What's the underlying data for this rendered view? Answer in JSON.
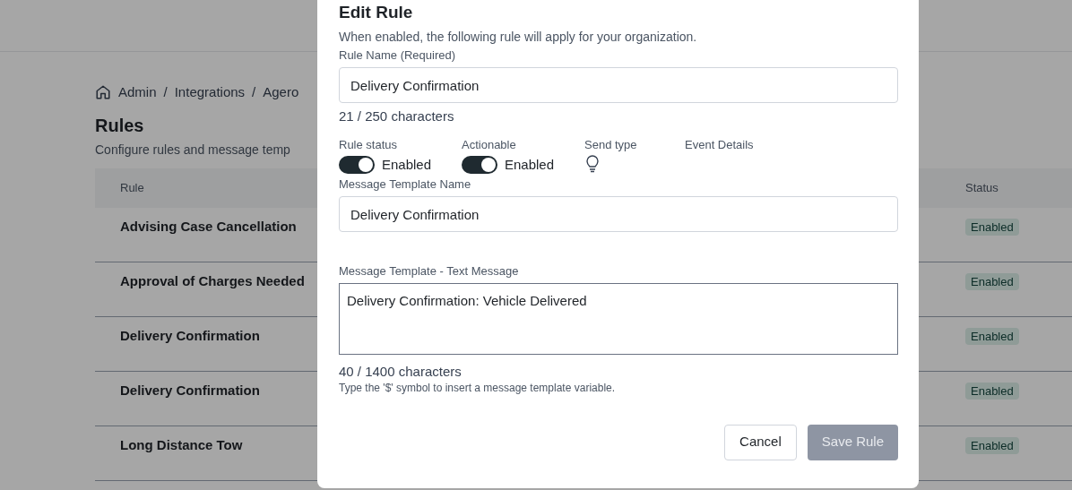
{
  "breadcrumb": [
    "Admin",
    "Integrations",
    "Agero"
  ],
  "breadcrumb_separators": [
    "/",
    "/"
  ],
  "page": {
    "title": "Rules",
    "subtitle": "Configure rules and message temp"
  },
  "table": {
    "columns": [
      "Rule",
      "Status"
    ],
    "rows": [
      {
        "rule": "Advising Case Cancellation",
        "status": "Enabled"
      },
      {
        "rule": "Approval of Charges Needed",
        "status": "Enabled"
      },
      {
        "rule": "Delivery Confirmation",
        "status": "Enabled"
      },
      {
        "rule": "Delivery Confirmation",
        "status": "Enabled"
      },
      {
        "rule": "Long Distance Tow",
        "status": "Enabled"
      }
    ]
  },
  "modal": {
    "title": "Edit Rule",
    "description": "When enabled, the following rule will apply for your organization.",
    "rule_name": {
      "label": "Rule Name (Required)",
      "value": "Delivery Confirmation",
      "count": "21 / 250 characters"
    },
    "switches": [
      {
        "label": "Rule status",
        "on": true,
        "text": "Enabled"
      },
      {
        "label": "Actionable",
        "on": true,
        "text": "Enabled"
      }
    ],
    "send_type": {
      "label": "Send type"
    },
    "event_details": {
      "label": "Event Details"
    },
    "template_name": {
      "label": "Message Template Name",
      "value": "Delivery Confirmation"
    },
    "template_text": {
      "label": "Message Template - Text Message",
      "value": "Delivery Confirmation: Vehicle Delivered",
      "count": "40 / 1400 characters",
      "hint": "Type the '$' symbol to insert a message template variable."
    },
    "buttons": [
      {
        "label": "Cancel",
        "kind": "secondary",
        "disabled": false
      },
      {
        "label": "Save Rule",
        "kind": "primary",
        "disabled": true
      }
    ]
  }
}
